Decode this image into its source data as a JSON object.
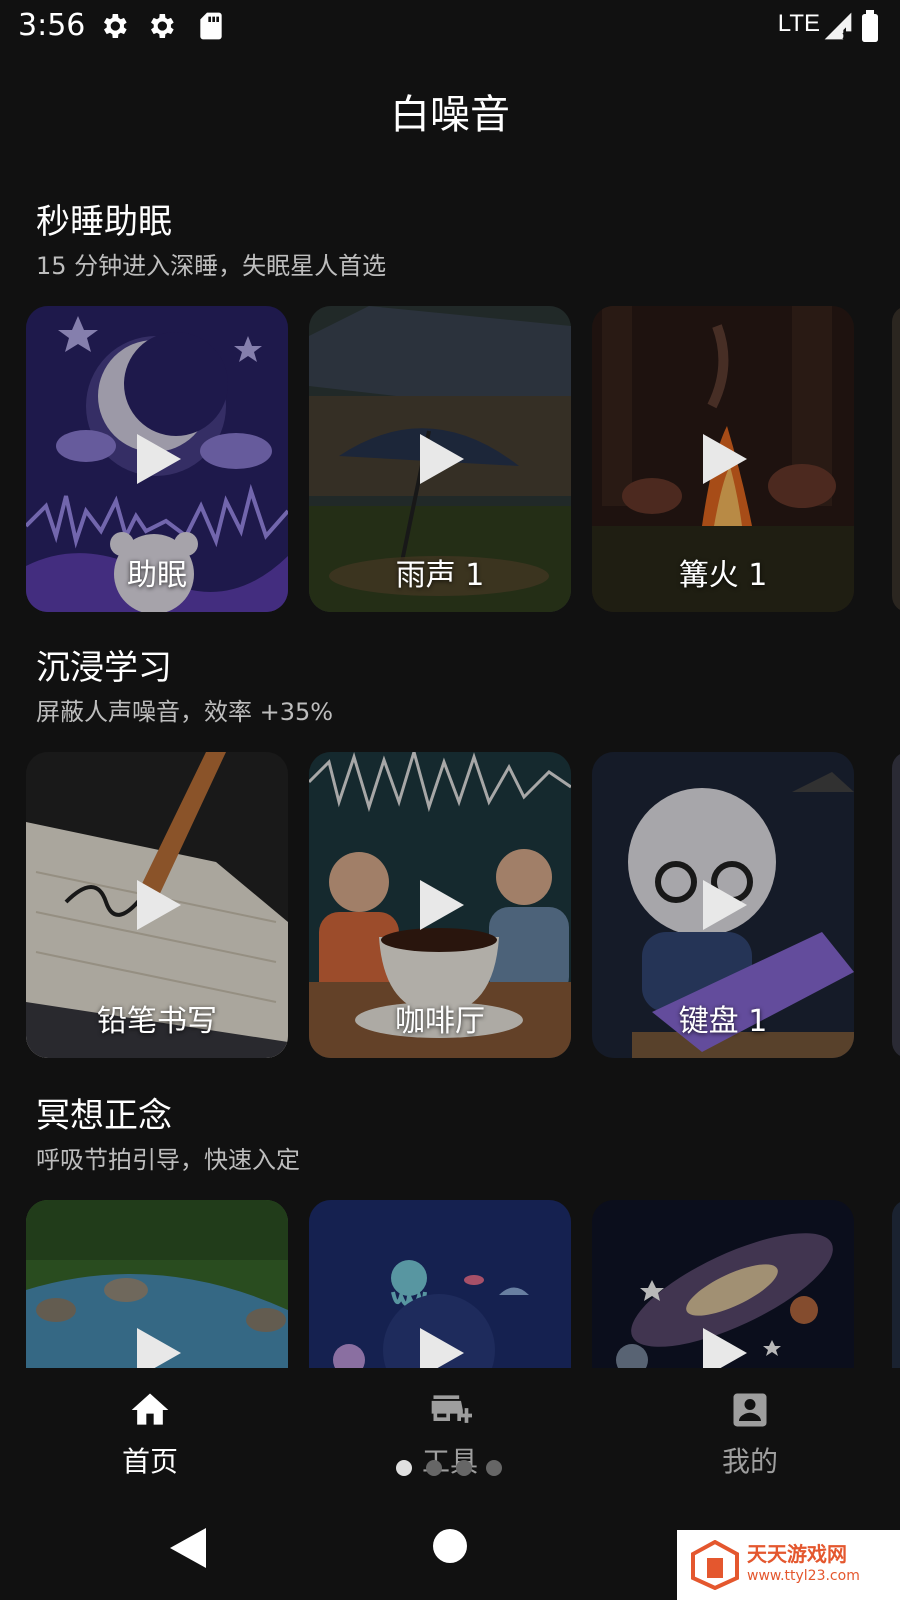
{
  "status_bar": {
    "time": "3:56",
    "icons": [
      "gear-icon",
      "gear-icon",
      "sd-card-icon"
    ],
    "network": "LTE",
    "right_icons": [
      "signal-icon",
      "battery-icon"
    ]
  },
  "header": {
    "title": "白噪音"
  },
  "sections": [
    {
      "title": "秒睡助眠",
      "subtitle": "15 分钟进入深睡，失眠星人首选",
      "cards": [
        {
          "label": "助眠",
          "art": "moon-bear"
        },
        {
          "label": "雨声 1",
          "art": "rain-umbrella"
        },
        {
          "label": "篝火 1",
          "art": "campfire"
        }
      ]
    },
    {
      "title": "沉浸学习",
      "subtitle": "屏蔽人声噪音，效率 +35%",
      "cards": [
        {
          "label": "铅笔书写",
          "art": "pencil-notebook"
        },
        {
          "label": "咖啡厅",
          "art": "coffee-cafe"
        },
        {
          "label": "键盘 1",
          "art": "keyboard"
        }
      ]
    },
    {
      "title": "冥想正念",
      "subtitle": "呼吸节拍引导，快速入定",
      "cards": [
        {
          "label": "",
          "art": "stream"
        },
        {
          "label": "",
          "art": "ocean"
        },
        {
          "label": "",
          "art": "galaxy"
        }
      ]
    }
  ],
  "bottom_nav": [
    {
      "label": "首页",
      "icon": "home-icon",
      "active": true
    },
    {
      "label": "工具",
      "icon": "store-add-icon",
      "active": false
    },
    {
      "label": "我的",
      "icon": "account-box-icon",
      "active": false
    }
  ],
  "pager": {
    "count": 4,
    "active_index": 0
  },
  "system_nav": [
    "back-icon",
    "home-circle-icon"
  ],
  "watermark": {
    "text": "天天游戏网",
    "url": "www.ttyl23.com"
  },
  "colors": {
    "background": "#111111",
    "active_nav": "#ffffff",
    "inactive_nav": "#9e9e9e"
  }
}
